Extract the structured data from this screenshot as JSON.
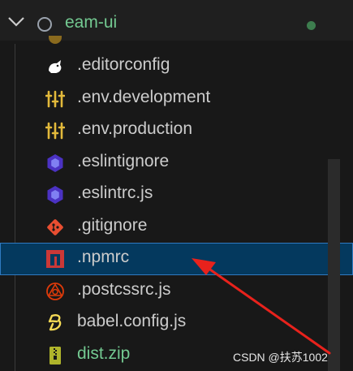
{
  "explorer": {
    "folder_name": "eam-ui",
    "items": [
      {
        "label": ".editorconfig",
        "icon": "editorconfig-icon"
      },
      {
        "label": ".env.development",
        "icon": "env-settings-icon"
      },
      {
        "label": ".env.production",
        "icon": "env-settings-icon"
      },
      {
        "label": ".eslintignore",
        "icon": "eslint-icon"
      },
      {
        "label": ".eslintrc.js",
        "icon": "eslint-icon"
      },
      {
        "label": ".gitignore",
        "icon": "git-icon"
      },
      {
        "label": ".npmrc",
        "icon": "npm-icon",
        "selected": true
      },
      {
        "label": ".postcssrc.js",
        "icon": "postcss-icon"
      },
      {
        "label": "babel.config.js",
        "icon": "babel-icon"
      },
      {
        "label": "dist.zip",
        "icon": "zip-icon",
        "status": "added"
      }
    ]
  },
  "watermark": "CSDN @扶苏1002",
  "colors": {
    "background": "#181818",
    "selected_row": "#04395e",
    "git_added_text": "#73c991",
    "annotation_arrow": "#e8221c"
  }
}
